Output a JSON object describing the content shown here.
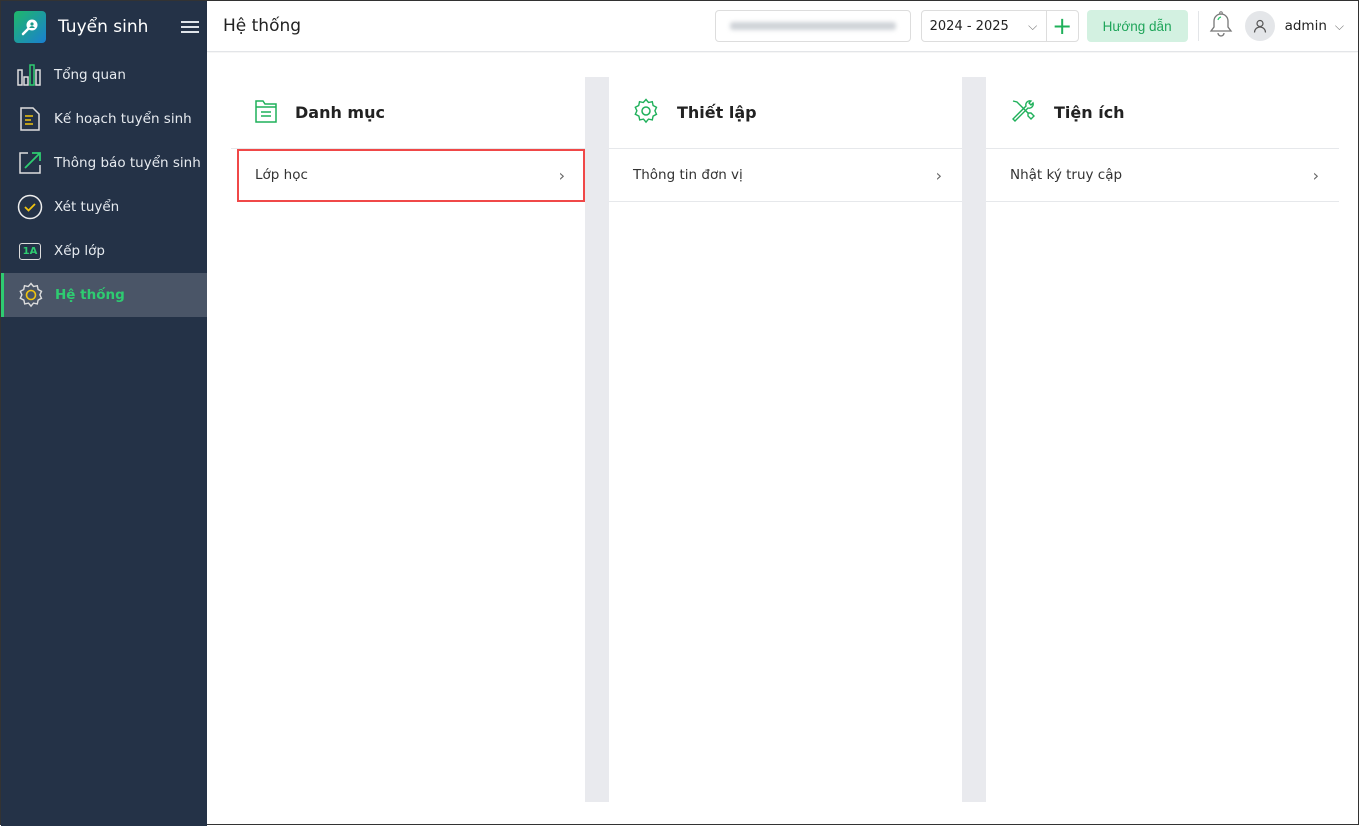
{
  "sidebar": {
    "brand": "Tuyển sinh",
    "items": [
      {
        "label": "Tổng quan"
      },
      {
        "label": "Kế hoạch tuyển sinh"
      },
      {
        "label": "Thông báo tuyển sinh"
      },
      {
        "label": "Xét tuyển"
      },
      {
        "label": "Xếp lớp",
        "badge": "1A"
      },
      {
        "label": "Hệ thống",
        "active": true
      }
    ]
  },
  "header": {
    "title": "Hệ thống",
    "year": "2024 - 2025",
    "guide": "Hướng dẫn",
    "user": "admin"
  },
  "cards": [
    {
      "title": "Danh mục",
      "items": [
        {
          "label": "Lớp học"
        }
      ]
    },
    {
      "title": "Thiết lập",
      "items": [
        {
          "label": "Thông tin đơn vị"
        }
      ]
    },
    {
      "title": "Tiện ích",
      "items": [
        {
          "label": "Nhật ký truy cập"
        }
      ]
    }
  ],
  "colors": {
    "sidebar": "#243247",
    "accent": "#2ecc71",
    "highlight": "#f04848"
  }
}
